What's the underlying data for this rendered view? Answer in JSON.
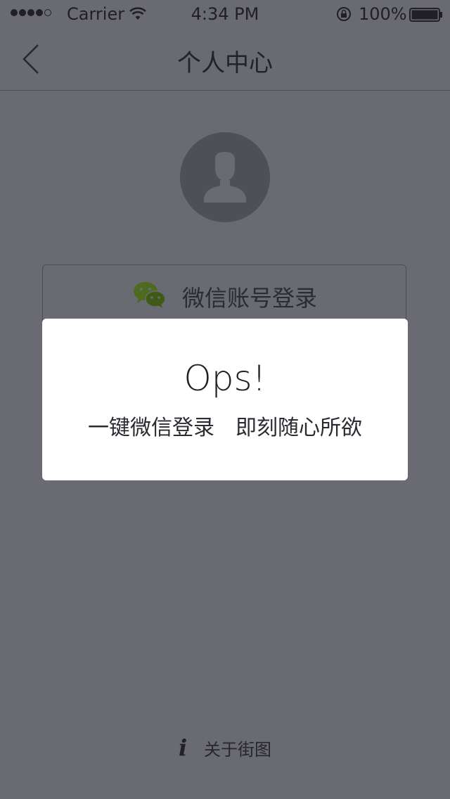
{
  "status_bar": {
    "carrier": "Carrier",
    "time": "4:34 PM",
    "battery": "100%"
  },
  "nav": {
    "title": "个人中心",
    "back_icon": "chevron-left-icon"
  },
  "avatar": {
    "icon": "user-silhouette-icon"
  },
  "login": {
    "label": "微信账号登录",
    "icon": "wechat-icon"
  },
  "popup": {
    "title": "Ops!",
    "message": "一键微信登录　即刻随心所欲"
  },
  "footer": {
    "about_label": "关于街图",
    "icon": "info-icon"
  },
  "colors": {
    "background": "#6a6a72",
    "popup": "#ffffff",
    "avatar": "#4f4f57",
    "wechat_green": "#4c6b1e"
  }
}
